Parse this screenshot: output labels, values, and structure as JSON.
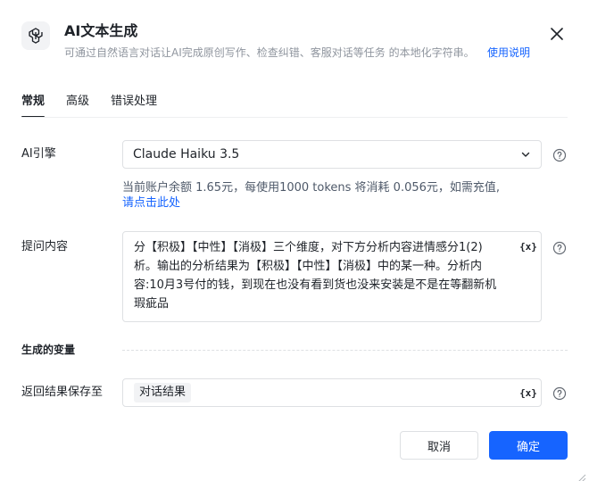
{
  "header": {
    "title": "AI文本生成",
    "description": "可通过自然语言对话让AI完成原创写作、检查纠错、客服对话等任务 的本地化字符串。",
    "help_link": "使用说明",
    "logo_icon": "openai-logo-icon",
    "close_icon": "close-icon"
  },
  "tabs": [
    {
      "label": "常规",
      "active": true
    },
    {
      "label": "高级",
      "active": false
    },
    {
      "label": "错误处理",
      "active": false
    }
  ],
  "form": {
    "engine": {
      "label": "AI引擎",
      "value": "Claude Haiku 3.5",
      "balance_text": "当前账户余额 1.65元，每使用1000 tokens 将消耗 0.056元，如需充值,",
      "recharge_link": "请点击此处"
    },
    "prompt": {
      "label": "提问内容",
      "value": "分【积极】【中性】【消极】三个维度，对下方分析内容进情感分1(2)析。输出的分析结果为【积极】【中性】【消极】中的某一种。分析内容:10月3号付的钱，到现在也没有看到货也没来安装是不是在等翻新机瑕疵品",
      "variable_button": "{x}"
    },
    "section_generated": "生成的变量",
    "result": {
      "label": "返回结果保存至",
      "tag": "对话结果",
      "variable_button": "{x}"
    }
  },
  "footer": {
    "cancel_label": "取消",
    "ok_label": "确定"
  },
  "colors": {
    "accent": "#1664ff",
    "border": "#dee0e3",
    "muted_text": "#8f959e"
  }
}
